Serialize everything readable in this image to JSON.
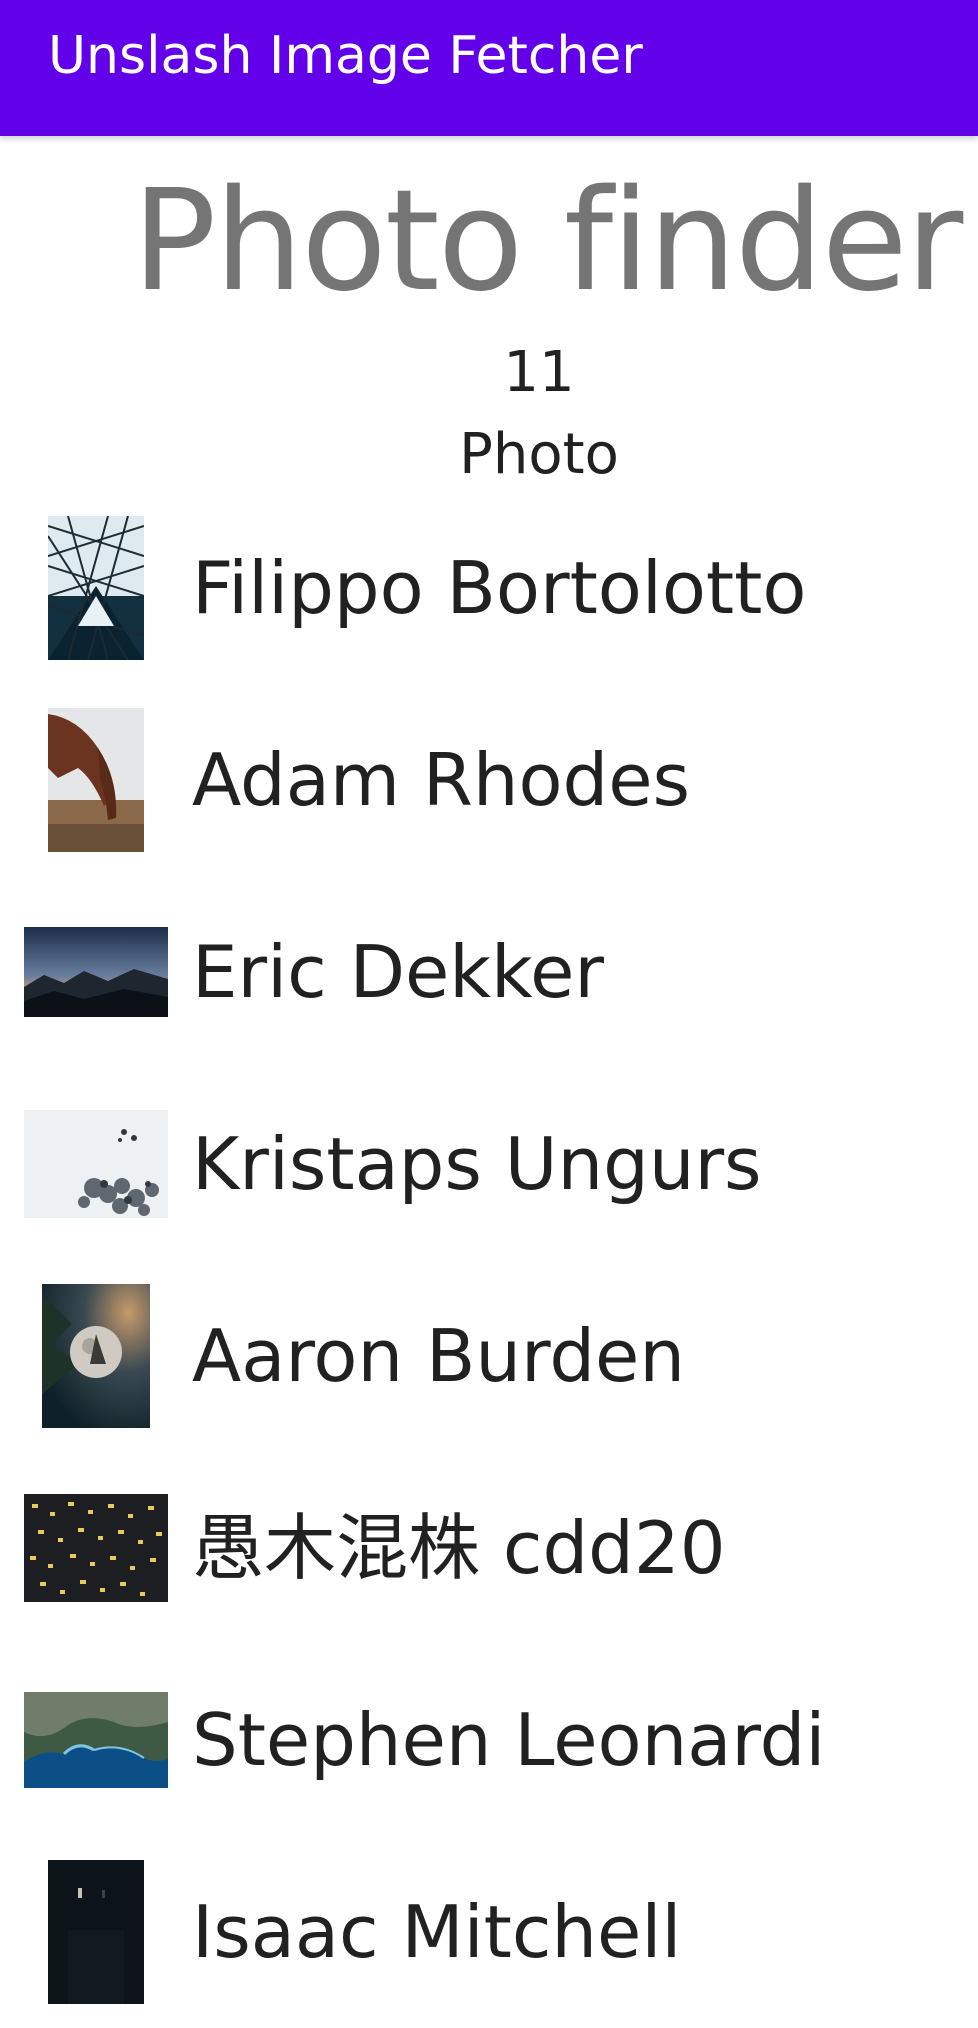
{
  "app_bar": {
    "title": "Unslash Image Fetcher"
  },
  "header": {
    "title": "Photo finder",
    "count": "11",
    "count_label": "Photo"
  },
  "photos": [
    {
      "author": "Filippo Bortolotto",
      "thumb_icon": "glass-dome-photo"
    },
    {
      "author": "Adam Rhodes",
      "thumb_icon": "horse-photo"
    },
    {
      "author": "Eric Dekker",
      "thumb_icon": "mountain-sunset-photo"
    },
    {
      "author": "Kristaps Ungurs",
      "thumb_icon": "snowy-forest-photo"
    },
    {
      "author": "Aaron Burden",
      "thumb_icon": "moon-photo"
    },
    {
      "author": "愚木混株 cdd20",
      "thumb_icon": "music-notes-photo"
    },
    {
      "author": "Stephen Leonardi",
      "thumb_icon": "coastline-photo"
    },
    {
      "author": "Isaac Mitchell",
      "thumb_icon": "dark-photo"
    }
  ],
  "colors": {
    "app_bar": "#6200ea",
    "title_gray": "#757575",
    "text": "#212121"
  }
}
